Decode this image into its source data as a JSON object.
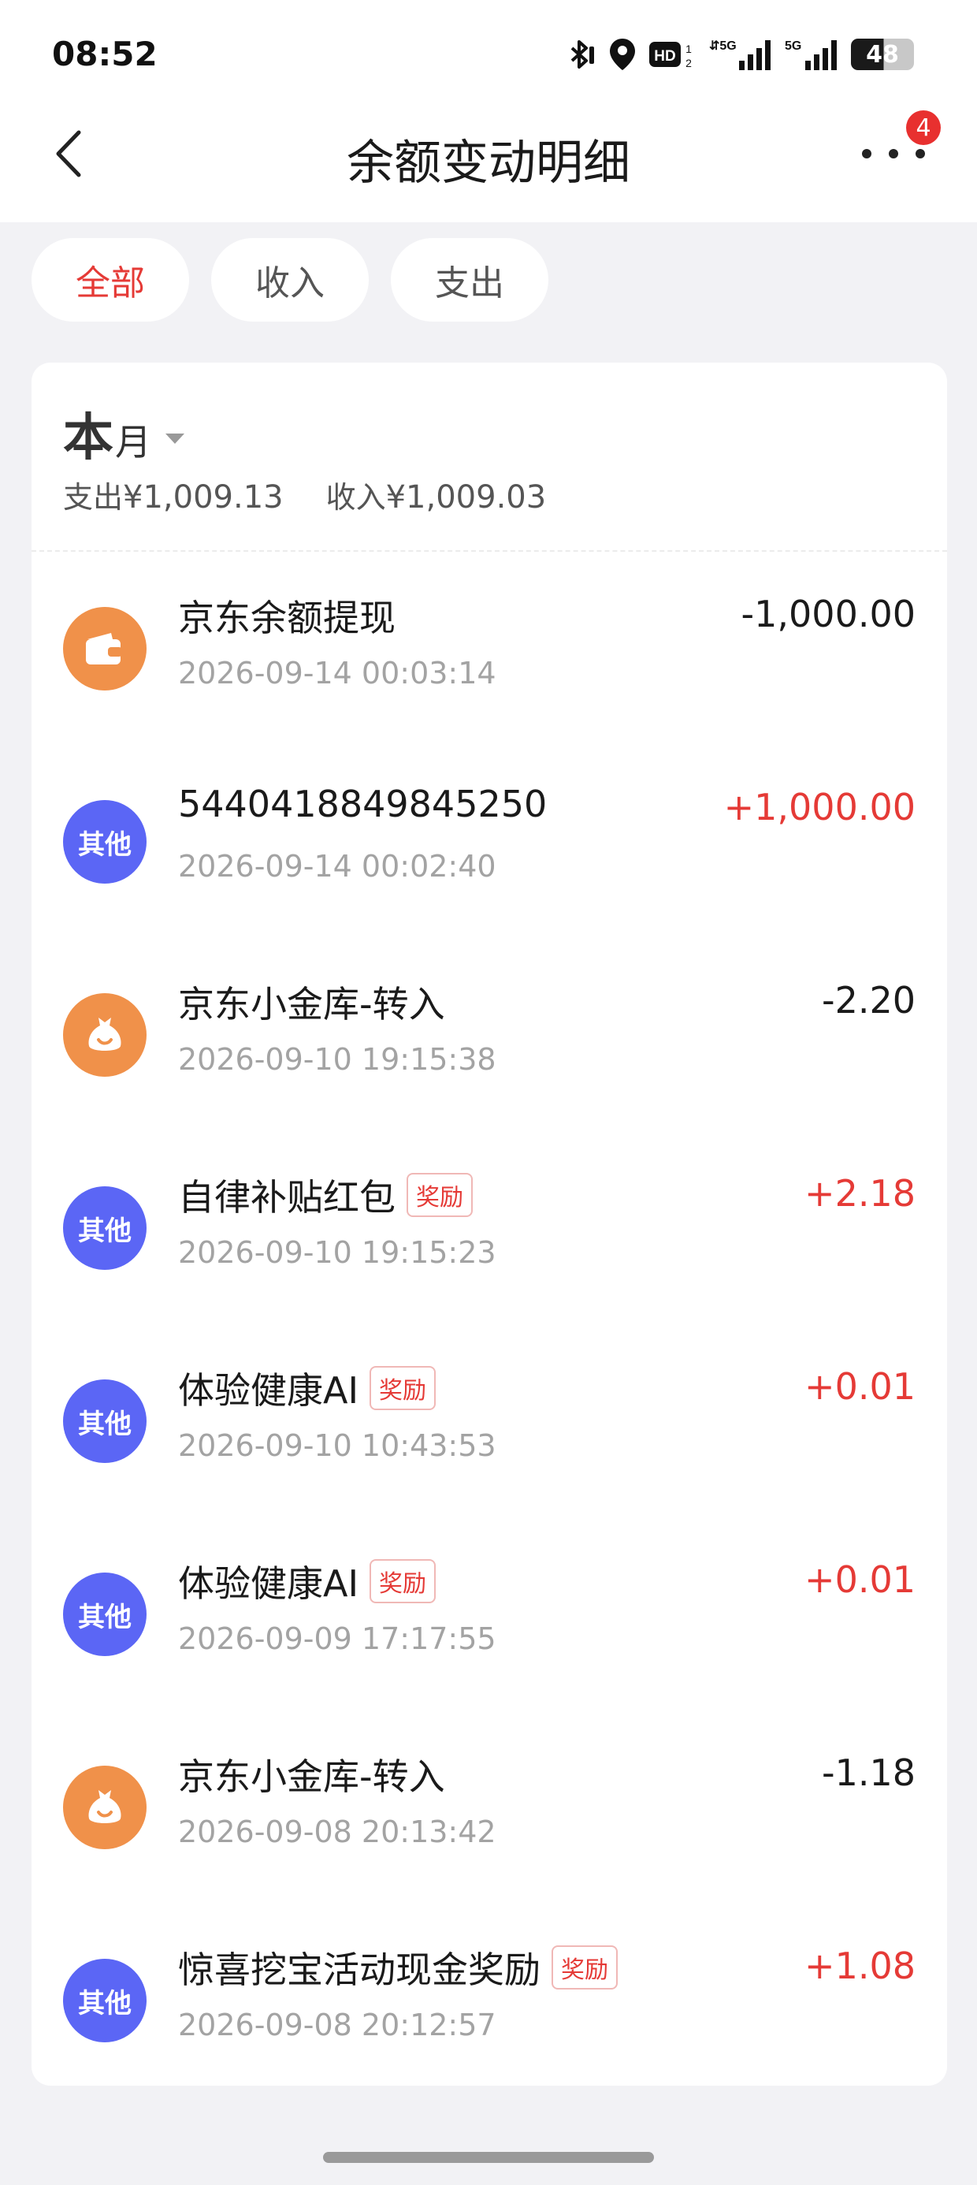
{
  "status_bar": {
    "time": "08:52",
    "battery_level": "48",
    "network_1": "5G",
    "network_2": "5G",
    "hd_label": "HD"
  },
  "nav": {
    "title": "余额变动明细",
    "more_badge": "4"
  },
  "filters": [
    {
      "label": "全部",
      "active": true
    },
    {
      "label": "收入",
      "active": false
    },
    {
      "label": "支出",
      "active": false
    }
  ],
  "summary": {
    "period_big": "本",
    "period_small": "月",
    "expense_label": "支出",
    "expense_amount": "¥1,009.13",
    "income_label": "收入",
    "income_amount": "¥1,009.03"
  },
  "transactions": [
    {
      "icon": "wallet-icon",
      "icon_color": "#f0914a",
      "icon_text": "",
      "title": "京东余额提现",
      "tag": "",
      "time": "2026-09-14 00:03:14",
      "amount": "-1,000.00",
      "income": false
    },
    {
      "icon": "other-icon",
      "icon_color": "#5b66f5",
      "icon_text": "其他",
      "title": "5440418849845250",
      "tag": "",
      "time": "2026-09-14 00:02:40",
      "amount": "+1,000.00",
      "income": true
    },
    {
      "icon": "money-bag-icon",
      "icon_color": "#f0914a",
      "icon_text": "",
      "title": "京东小金库-转入",
      "tag": "",
      "time": "2026-09-10 19:15:38",
      "amount": "-2.20",
      "income": false
    },
    {
      "icon": "other-icon",
      "icon_color": "#5b66f5",
      "icon_text": "其他",
      "title": "自律补贴红包",
      "tag": "奖励",
      "time": "2026-09-10 19:15:23",
      "amount": "+2.18",
      "income": true
    },
    {
      "icon": "other-icon",
      "icon_color": "#5b66f5",
      "icon_text": "其他",
      "title": "体验健康AI",
      "tag": "奖励",
      "time": "2026-09-10 10:43:53",
      "amount": "+0.01",
      "income": true
    },
    {
      "icon": "other-icon",
      "icon_color": "#5b66f5",
      "icon_text": "其他",
      "title": "体验健康AI",
      "tag": "奖励",
      "time": "2026-09-09 17:17:55",
      "amount": "+0.01",
      "income": true
    },
    {
      "icon": "money-bag-icon",
      "icon_color": "#f0914a",
      "icon_text": "",
      "title": "京东小金库-转入",
      "tag": "",
      "time": "2026-09-08 20:13:42",
      "amount": "-1.18",
      "income": false
    },
    {
      "icon": "other-icon",
      "icon_color": "#5b66f5",
      "icon_text": "其他",
      "title": "惊喜挖宝活动现金奖励",
      "tag": "奖励",
      "time": "2026-09-08 20:12:57",
      "amount": "+1.08",
      "income": true
    }
  ]
}
